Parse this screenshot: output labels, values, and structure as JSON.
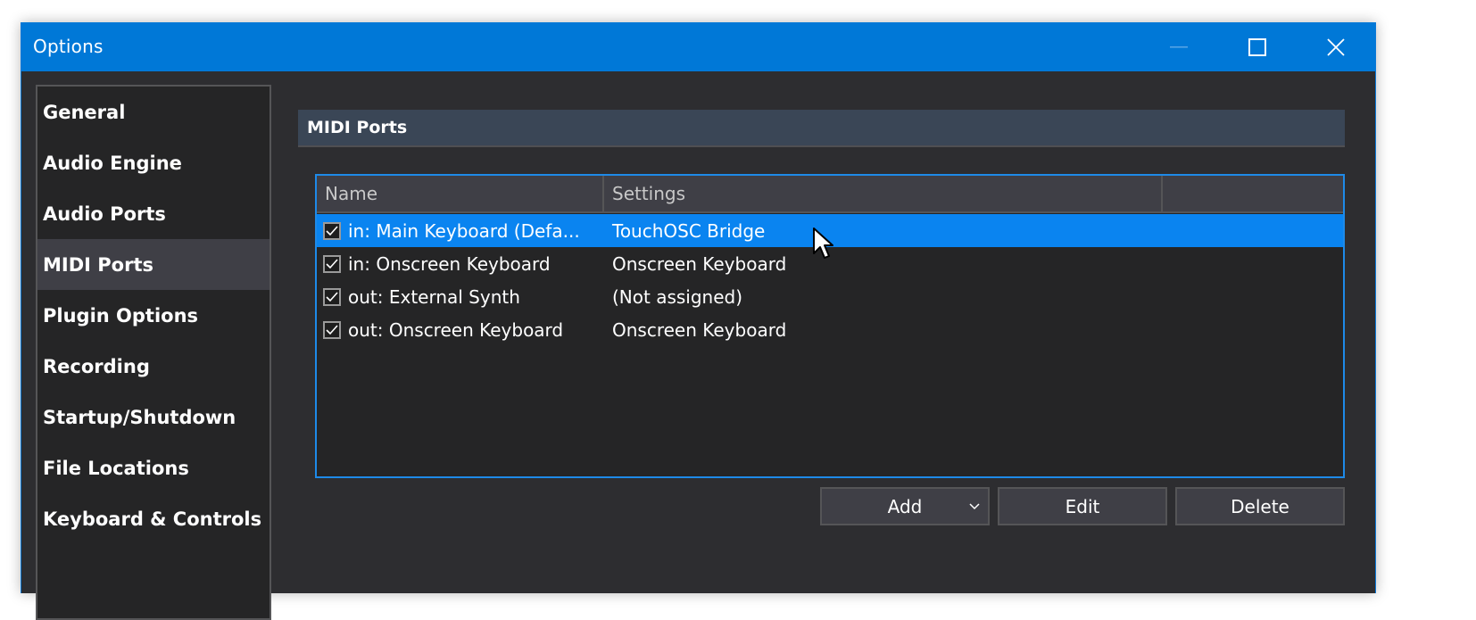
{
  "window": {
    "title": "Options",
    "controls": {
      "minimize": "minimize-icon",
      "maximize": "maximize-icon",
      "close": "close-icon"
    }
  },
  "sidebar": {
    "items": [
      {
        "label": "General",
        "active": false
      },
      {
        "label": "Audio Engine",
        "active": false
      },
      {
        "label": "Audio Ports",
        "active": false
      },
      {
        "label": "MIDI Ports",
        "active": true
      },
      {
        "label": "Plugin Options",
        "active": false
      },
      {
        "label": "Recording",
        "active": false
      },
      {
        "label": "Startup/Shutdown",
        "active": false
      },
      {
        "label": "File Locations",
        "active": false
      },
      {
        "label": "Keyboard & Controls",
        "active": false
      }
    ]
  },
  "main": {
    "section_title": "MIDI Ports",
    "table": {
      "columns": [
        "Name",
        "Settings",
        ""
      ],
      "rows": [
        {
          "checked": true,
          "name": "in: Main Keyboard (Defa...",
          "settings": "TouchOSC Bridge",
          "selected": true
        },
        {
          "checked": true,
          "name": "in: Onscreen Keyboard",
          "settings": "Onscreen Keyboard",
          "selected": false
        },
        {
          "checked": true,
          "name": "out: External Synth",
          "settings": "(Not assigned)",
          "selected": false
        },
        {
          "checked": true,
          "name": "out: Onscreen Keyboard",
          "settings": "Onscreen Keyboard",
          "selected": false
        }
      ]
    },
    "buttons": {
      "add": "Add",
      "edit": "Edit",
      "delete": "Delete"
    }
  },
  "colors": {
    "titlebar": "#0078d7",
    "selection": "#0a84f0",
    "focus_border": "#1e8ae8",
    "background": "#2d2d30",
    "panel": "#252526",
    "section_header": "#3a4656"
  }
}
